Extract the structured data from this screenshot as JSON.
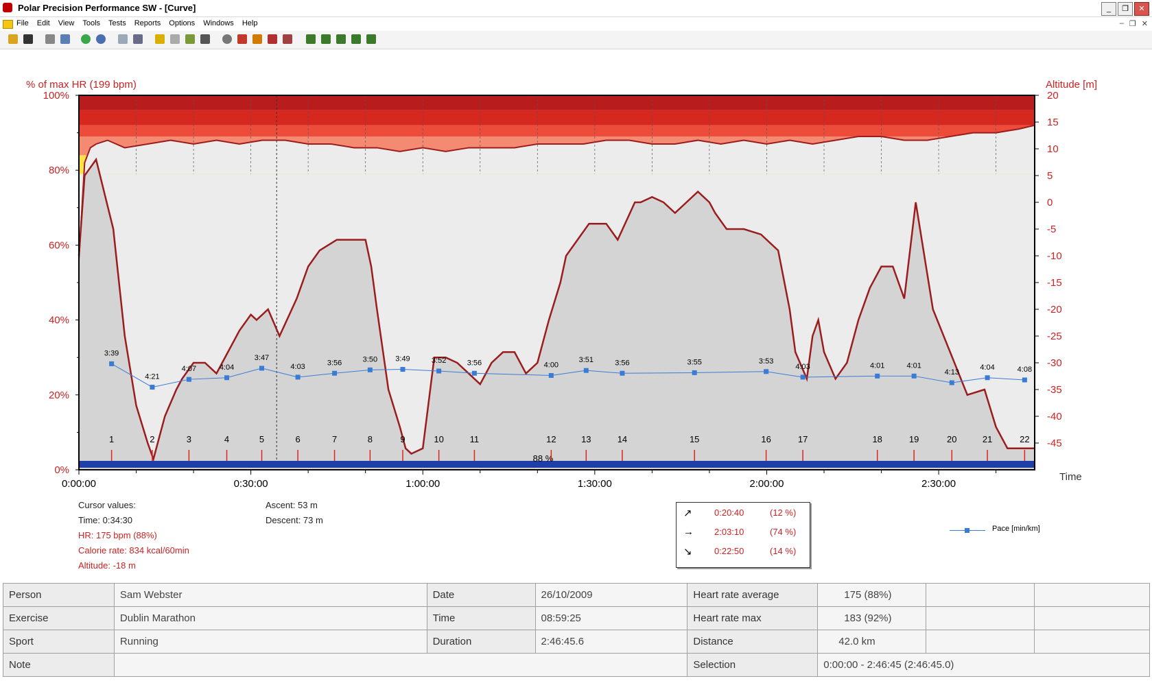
{
  "window": {
    "title": "Polar Precision Performance SW - [Curve]",
    "buttons": {
      "minimize": "_",
      "restore": "❐",
      "close": "✕"
    }
  },
  "menu": {
    "items": [
      "File",
      "Edit",
      "View",
      "Tools",
      "Tests",
      "Reports",
      "Options",
      "Windows",
      "Help"
    ],
    "mdi": {
      "minimize": "–",
      "restore": "❐",
      "close": "✕"
    }
  },
  "colors": {
    "hr_line": "#9b1c1c",
    "altitude_fill": "#d4d4d4",
    "pace_line": "#3a7bd5",
    "axis_text": "#cc2222",
    "zone_bar": "#1f3fa8"
  },
  "chart_data": {
    "type": "line",
    "left_axis_label": "% of max HR (199 bpm)",
    "right_axis_label": "Altitude [m]",
    "x_axis_label": "Time",
    "x_ticks": [
      "0:00:00",
      "0:30:00",
      "1:00:00",
      "1:30:00",
      "2:00:00",
      "2:30:00"
    ],
    "x_range_min": [
      0,
      166.75
    ],
    "y_left_ticks": [
      "0%",
      "20%",
      "40%",
      "60%",
      "80%",
      "100%"
    ],
    "y_left_range_pct": [
      0,
      100
    ],
    "y_right_ticks": [
      "20",
      "15",
      "10",
      "5",
      "0",
      "-5",
      "-10",
      "-15",
      "-20",
      "-25",
      "-30",
      "-35",
      "-40",
      "-45"
    ],
    "y_right_range_m": [
      -50,
      20
    ],
    "altitude": {
      "name": "Altitude",
      "t_min": [
        0,
        1,
        3,
        6,
        8,
        10,
        12,
        13,
        15,
        17,
        18,
        20,
        22,
        24,
        26,
        28,
        30,
        31,
        33,
        35,
        38,
        40,
        42,
        45,
        46,
        48,
        50,
        51,
        52,
        54,
        56,
        57,
        58,
        60,
        62,
        64,
        66,
        68,
        70,
        72,
        74,
        76,
        78,
        80,
        82,
        84,
        85,
        87,
        89,
        92,
        94,
        97,
        98,
        100,
        102,
        104,
        106,
        108,
        110,
        111,
        113,
        116,
        119,
        122,
        124,
        125,
        127,
        128,
        129,
        130,
        132,
        134,
        136,
        138,
        140,
        142,
        144,
        146,
        149,
        152,
        155,
        158,
        160,
        162,
        164,
        166.75
      ],
      "m": [
        -10,
        5,
        8,
        -5,
        -25,
        -38,
        -45,
        -48,
        -40,
        -35,
        -33,
        -30,
        -30,
        -32,
        -28,
        -24,
        -21,
        -22,
        -20,
        -25,
        -18,
        -12,
        -9,
        -7,
        -7,
        -7,
        -7,
        -12,
        -20,
        -35,
        -42,
        -46,
        -47,
        -46,
        -29,
        -29,
        -30,
        -32,
        -34,
        -30,
        -28,
        -28,
        -32,
        -30,
        -22,
        -15,
        -10,
        -7,
        -4,
        -4,
        -7,
        0,
        0,
        1,
        0,
        -2,
        0,
        2,
        0,
        -2,
        -5,
        -5,
        -6,
        -9,
        -20,
        -28,
        -33,
        -25,
        -22,
        -28,
        -33,
        -30,
        -22,
        -16,
        -12,
        -12,
        -18,
        0,
        -20,
        -28,
        -36,
        -35,
        -42,
        -46,
        -46,
        -46
      ]
    },
    "heart_rate": {
      "name": "HR",
      "t_min": [
        0,
        1,
        2,
        3,
        5,
        8,
        12,
        16,
        20,
        24,
        28,
        32,
        36,
        40,
        44,
        48,
        52,
        56,
        60,
        64,
        68,
        72,
        76,
        80,
        84,
        88,
        92,
        96,
        100,
        104,
        108,
        112,
        116,
        120,
        124,
        128,
        132,
        136,
        140,
        144,
        148,
        152,
        156,
        160,
        164,
        166.75
      ],
      "pct": [
        56,
        82,
        86,
        87,
        88,
        86,
        87,
        88,
        87,
        88,
        87,
        88,
        88,
        87,
        87,
        86,
        86,
        85,
        86,
        85,
        86,
        86,
        86,
        87,
        87,
        87,
        88,
        88,
        87,
        87,
        88,
        87,
        88,
        87,
        88,
        87,
        88,
        89,
        89,
        88,
        88,
        89,
        90,
        90,
        91,
        92
      ]
    },
    "pace": {
      "name": "Pace [min/km]",
      "markers": [
        {
          "lap": "1",
          "t_min": 5.7,
          "label": "3:39",
          "pace_s": 219
        },
        {
          "lap": "2",
          "t_min": 12.8,
          "label": "4:21",
          "pace_s": 261
        },
        {
          "lap": "3",
          "t_min": 19.2,
          "label": "4:07",
          "pace_s": 247
        },
        {
          "lap": "4",
          "t_min": 25.8,
          "label": "4:04",
          "pace_s": 244
        },
        {
          "lap": "5",
          "t_min": 31.9,
          "label": "3:47",
          "pace_s": 227
        },
        {
          "lap": "6",
          "t_min": 38.2,
          "label": "4:03",
          "pace_s": 243
        },
        {
          "lap": "7",
          "t_min": 44.6,
          "label": "3:56",
          "pace_s": 236
        },
        {
          "lap": "8",
          "t_min": 50.8,
          "label": "3:50",
          "pace_s": 230
        },
        {
          "lap": "9",
          "t_min": 56.5,
          "label": "3:49",
          "pace_s": 229
        },
        {
          "lap": "10",
          "t_min": 62.8,
          "label": "3:52",
          "pace_s": 232
        },
        {
          "lap": "11",
          "t_min": 69.0,
          "label": "3:56",
          "pace_s": 236
        },
        {
          "lap": "12",
          "t_min": 82.4,
          "label": "4:00",
          "pace_s": 240
        },
        {
          "lap": "13",
          "t_min": 88.5,
          "label": "3:51",
          "pace_s": 231
        },
        {
          "lap": "14",
          "t_min": 94.8,
          "label": "3:56",
          "pace_s": 236
        },
        {
          "lap": "15",
          "t_min": 107.4,
          "label": "3:55",
          "pace_s": 235
        },
        {
          "lap": "16",
          "t_min": 119.9,
          "label": "3:53",
          "pace_s": 233
        },
        {
          "lap": "17",
          "t_min": 126.3,
          "label": "4:03",
          "pace_s": 243
        },
        {
          "lap": "18",
          "t_min": 139.3,
          "label": "4:01",
          "pace_s": 241
        },
        {
          "lap": "19",
          "t_min": 145.7,
          "label": "4:01",
          "pace_s": 241
        },
        {
          "lap": "20",
          "t_min": 152.3,
          "label": "4:13",
          "pace_s": 253
        },
        {
          "lap": "21",
          "t_min": 158.5,
          "label": "4:04",
          "pace_s": 244
        },
        {
          "lap": "22",
          "t_min": 165.0,
          "label": "4:08",
          "pace_s": 248
        }
      ],
      "pace_axis_s": [
        200,
        280
      ]
    },
    "zone_bar_label": "88 %",
    "cursor_t_min": 34.5
  },
  "cursor": {
    "header": "Cursor values:",
    "time": "Time: 0:34:30",
    "hr": "HR: 175 bpm (88%)",
    "calorie": "Calorie rate: 834 kcal/60min",
    "altitude": "Altitude: -18 m",
    "ascent": "Ascent: 53 m",
    "descent": "Descent: 73 m"
  },
  "terrain": [
    {
      "icon": "uphill-arrow",
      "glyph": "↗",
      "time": "0:20:40",
      "pct": "(12 %)"
    },
    {
      "icon": "flat-arrow",
      "glyph": "→",
      "time": "2:03:10",
      "pct": "(74 %)"
    },
    {
      "icon": "downhill-arrow",
      "glyph": "↘",
      "time": "0:22:50",
      "pct": "(14 %)"
    }
  ],
  "legend": {
    "pace": "Pace [min/km]"
  },
  "summary": {
    "rows": [
      {
        "l1": "Person",
        "v1": "Sam Webster",
        "l2": "Date",
        "v2": "26/10/2009",
        "l3": "Heart rate average",
        "v3": "175 (88%)"
      },
      {
        "l1": "Exercise",
        "v1": "Dublin Marathon",
        "l2": "Time",
        "v2": "08:59:25",
        "l3": "Heart rate max",
        "v3": "183 (92%)"
      },
      {
        "l1": "Sport",
        "v1": "Running",
        "l2": "Duration",
        "v2": "2:46:45.6",
        "l3": "Distance",
        "v3": "42.0 km"
      }
    ],
    "note_label": "Note",
    "note_value": "",
    "selection_label": "Selection",
    "selection_value": "0:00:00 - 2:46:45 (2:46:45.0)"
  }
}
